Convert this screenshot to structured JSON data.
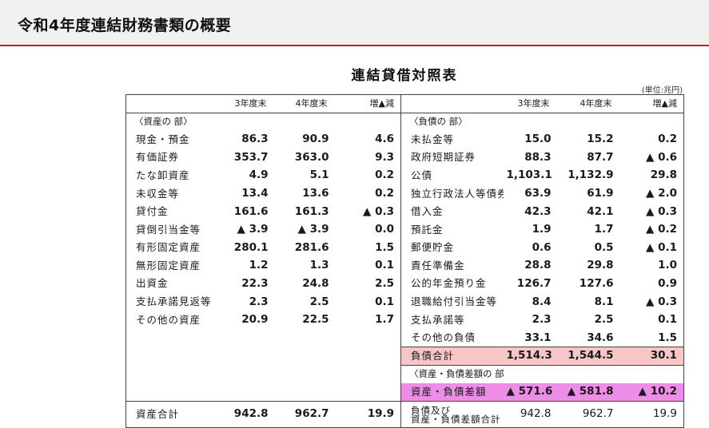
{
  "header": {
    "title": "令和4年度連結財務書類の概要"
  },
  "table": {
    "title": "連結貸借対照表",
    "unit": "(単位:兆円)",
    "col_headers": {
      "y3": "3年度末",
      "y4": "4年度末",
      "diff": "増▲減"
    },
    "left_section": "〈資産の 部〉",
    "right_section": "〈負債の 部〉",
    "assets": [
      {
        "label": "現金・預金",
        "y3": "86.3",
        "y4": "90.9",
        "diff": "4.6"
      },
      {
        "label": "有価証券",
        "y3": "353.7",
        "y4": "363.0",
        "diff": "9.3"
      },
      {
        "label": "たな卸資産",
        "y3": "4.9",
        "y4": "5.1",
        "diff": "0.2"
      },
      {
        "label": "未収金等",
        "y3": "13.4",
        "y4": "13.6",
        "diff": "0.2"
      },
      {
        "label": "貸付金",
        "y3": "161.6",
        "y4": "161.3",
        "diff": "▲ 0.3"
      },
      {
        "label": "貸倒引当金等",
        "y3": "▲ 3.9",
        "y4": "▲ 3.9",
        "diff": "0.0"
      },
      {
        "label": "有形固定資産",
        "y3": "280.1",
        "y4": "281.6",
        "diff": "1.5"
      },
      {
        "label": "無形固定資産",
        "y3": "1.2",
        "y4": "1.3",
        "diff": "0.1"
      },
      {
        "label": "出資金",
        "y3": "22.3",
        "y4": "24.8",
        "diff": "2.5"
      },
      {
        "label": "支払承諾見返等",
        "y3": "2.3",
        "y4": "2.5",
        "diff": "0.1"
      },
      {
        "label": "その他の資産",
        "y3": "20.9",
        "y4": "22.5",
        "diff": "1.7"
      }
    ],
    "liabilities": [
      {
        "label": "未払金等",
        "y3": "15.0",
        "y4": "15.2",
        "diff": "0.2"
      },
      {
        "label": "政府短期証券",
        "y3": "88.3",
        "y4": "87.7",
        "diff": "▲ 0.6"
      },
      {
        "label": "公債",
        "y3": "1,103.1",
        "y4": "1,132.9",
        "diff": "29.8"
      },
      {
        "label": "独立行政法人等債券",
        "y3": "63.9",
        "y4": "61.9",
        "diff": "▲ 2.0"
      },
      {
        "label": "借入金",
        "y3": "42.3",
        "y4": "42.1",
        "diff": "▲ 0.3"
      },
      {
        "label": "預託金",
        "y3": "1.9",
        "y4": "1.7",
        "diff": "▲ 0.2"
      },
      {
        "label": "郵便貯金",
        "y3": "0.6",
        "y4": "0.5",
        "diff": "▲ 0.1"
      },
      {
        "label": "責任準備金",
        "y3": "28.8",
        "y4": "29.8",
        "diff": "1.0"
      },
      {
        "label": "公的年金預り金",
        "y3": "126.7",
        "y4": "127.6",
        "diff": "0.9"
      },
      {
        "label": "退職給付引当金等",
        "y3": "8.4",
        "y4": "8.1",
        "diff": "▲ 0.3"
      },
      {
        "label": "支払承諾等",
        "y3": "2.3",
        "y4": "2.5",
        "diff": "0.1"
      },
      {
        "label": "その他の負債",
        "y3": "33.1",
        "y4": "34.6",
        "diff": "1.5"
      }
    ],
    "liab_total": {
      "label": "負債合計",
      "y3": "1,514.3",
      "y4": "1,544.5",
      "diff": "30.1"
    },
    "net_section": "〈資産・負債差額の 部〉",
    "net": {
      "label": "資産・負債差額",
      "y3": "▲ 571.6",
      "y4": "▲ 581.8",
      "diff": "▲ 10.2"
    },
    "asset_total": {
      "label": "資産合計",
      "y3": "942.8",
      "y4": "962.7",
      "diff": "19.9"
    },
    "grand_total": {
      "label_line1": "負債及び",
      "label_line2": "資産・負債差額合計",
      "y3": "942.8",
      "y4": "962.7",
      "diff": "19.9"
    },
    "colors": {
      "header_rule": "#b5272d",
      "total_highlight": "#f8c6c6",
      "net_highlight": "#ee8de8"
    }
  }
}
